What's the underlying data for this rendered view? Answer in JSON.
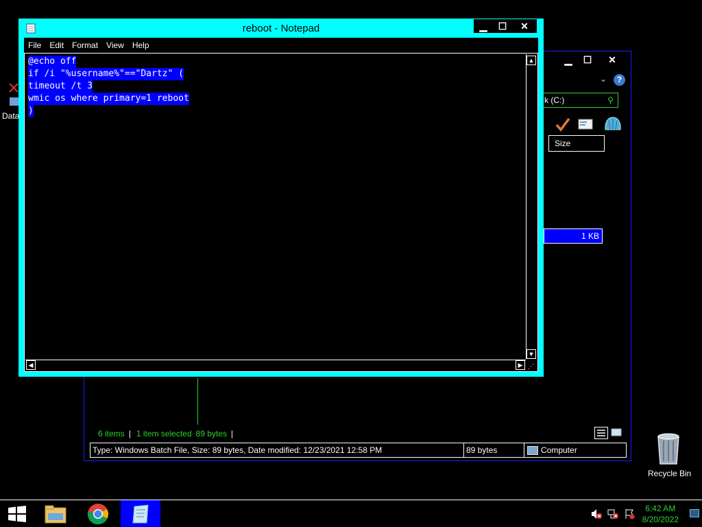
{
  "desktop": {
    "icons": [
      {
        "label": "Data",
        "icon": "data-icon"
      },
      {
        "label": "Recycle Bin",
        "icon": "recycle-bin-icon"
      }
    ]
  },
  "explorer": {
    "search_text": "k (C:)",
    "size_column": "Size",
    "selected_file_size": "1 KB",
    "status": {
      "items": "6 items",
      "selected": "1 item selected",
      "bytes": "89 bytes"
    },
    "details": {
      "info": "Type: Windows Batch File, Size: 89 bytes, Date modified: 12/23/2021 12:58 PM",
      "size": "89 bytes",
      "location": "Computer"
    }
  },
  "notepad": {
    "title": "reboot - Notepad",
    "menu": [
      "File",
      "Edit",
      "Format",
      "View",
      "Help"
    ],
    "lines": [
      "@echo off",
      "if /i \"%username%\"==\"Dartz\" (",
      "timeout /t 3",
      "wmic os where primary=1 reboot",
      ")"
    ]
  },
  "taskbar": {
    "time": "6:42 AM",
    "date": "8/20/2022"
  },
  "colors": {
    "accent": "#00ffff",
    "selection": "#0000ff",
    "green": "#2bd42b"
  }
}
